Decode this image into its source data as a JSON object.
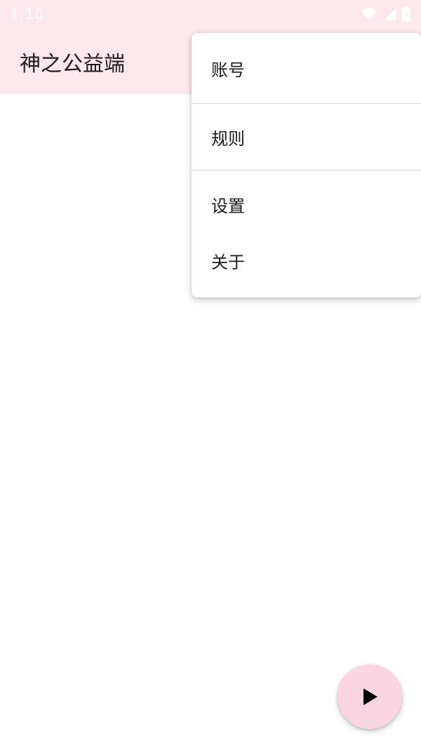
{
  "status_bar": {
    "time": "1:10",
    "icons": [
      "wifi-icon",
      "signal-icon",
      "battery-icon"
    ]
  },
  "app_bar": {
    "title": "神之公益端"
  },
  "overflow_menu": {
    "items": [
      {
        "label": "账号"
      },
      {
        "label": "规则"
      },
      {
        "label": "设置"
      },
      {
        "label": "关于"
      }
    ]
  },
  "fab": {
    "icon": "play-icon"
  },
  "colors": {
    "app_bar_background": "#fde8ee",
    "fab_background": "#fad6e2",
    "text": "#1f1a1c"
  }
}
